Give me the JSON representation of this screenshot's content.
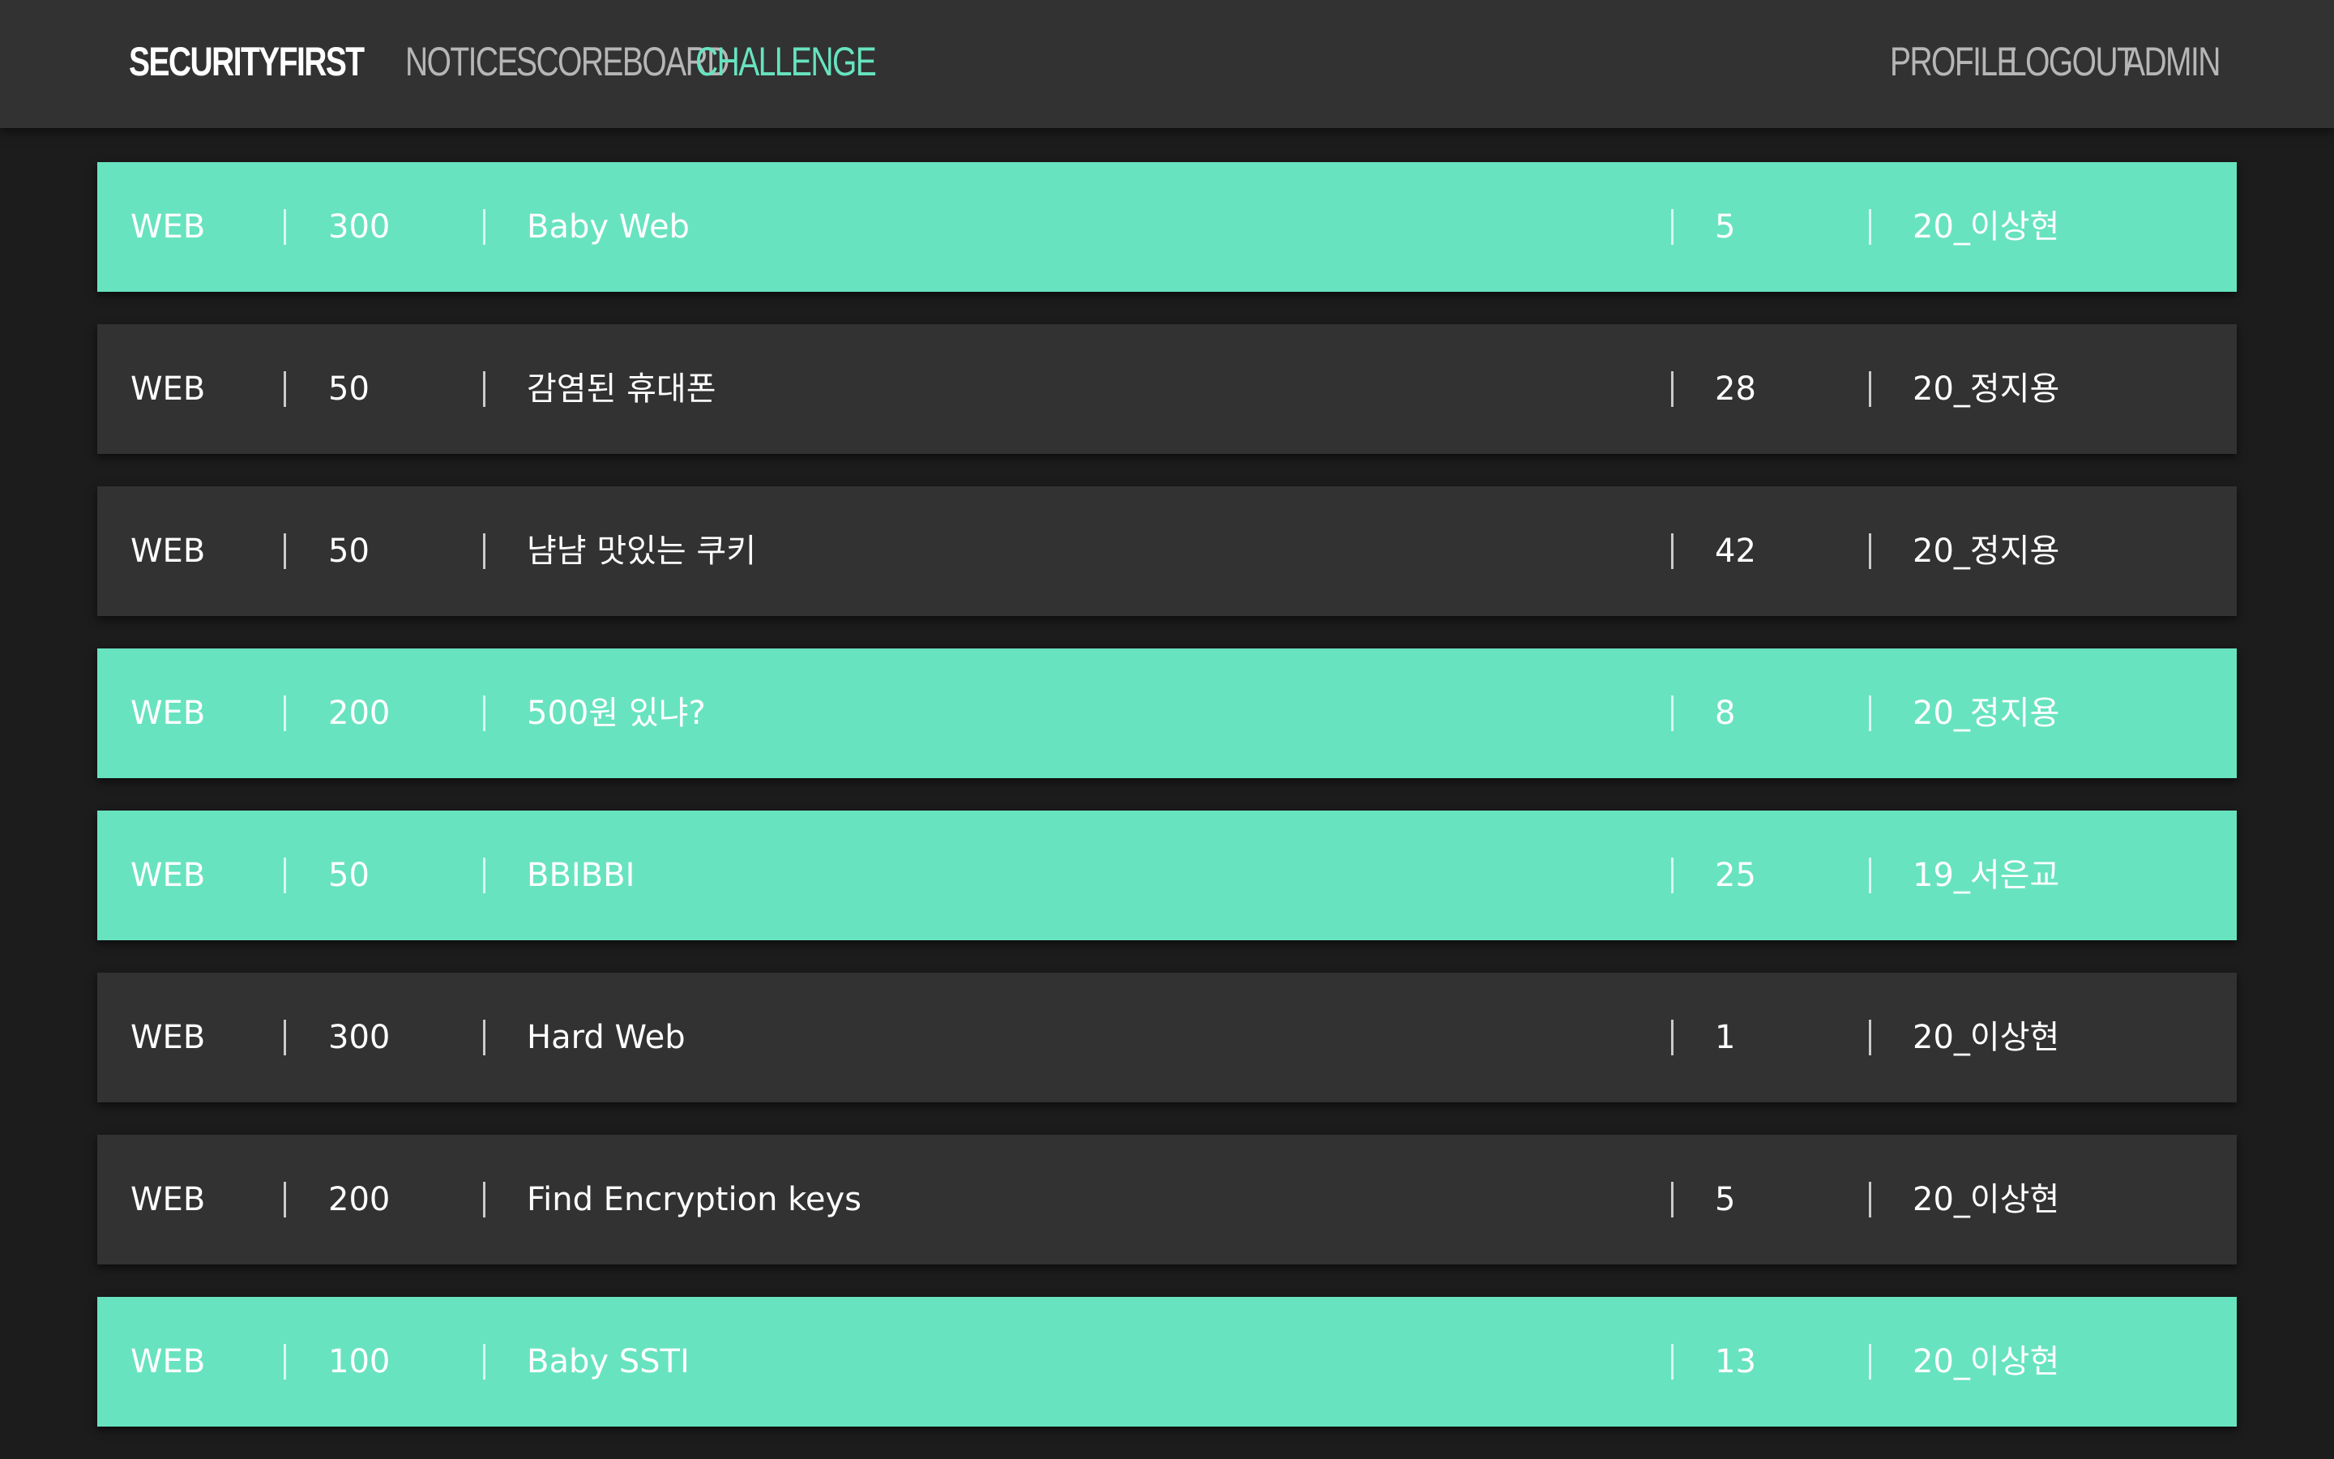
{
  "nav": {
    "brand": "SECURITYFIRST",
    "links": [
      "NOTICE",
      "SCOREBOARD",
      "CHALLENGE"
    ],
    "active": "CHALLENGE",
    "right_links": [
      "PROFILE",
      "LOGOUT",
      "ADMIN"
    ]
  },
  "colors": {
    "navbar_bg": "#323232",
    "page_bg": "#1c1c1c",
    "accent_solved": "#68e3bf",
    "unsolved_row": "#323232"
  },
  "challenges": [
    {
      "category": "WEB",
      "score": "300",
      "name": "Baby Web",
      "solves": "5",
      "author": "20_이상현",
      "solved": true
    },
    {
      "category": "WEB",
      "score": "50",
      "name": "감염된 휴대폰",
      "solves": "28",
      "author": "20_정지용",
      "solved": false
    },
    {
      "category": "WEB",
      "score": "50",
      "name": "냠냠 맛있는 쿠키",
      "solves": "42",
      "author": "20_정지용",
      "solved": false
    },
    {
      "category": "WEB",
      "score": "200",
      "name": "500원 있냐?",
      "solves": "8",
      "author": "20_정지용",
      "solved": true
    },
    {
      "category": "WEB",
      "score": "50",
      "name": "BBIBBI",
      "solves": "25",
      "author": "19_서은교",
      "solved": true
    },
    {
      "category": "WEB",
      "score": "300",
      "name": "Hard Web",
      "solves": "1",
      "author": "20_이상현",
      "solved": false
    },
    {
      "category": "WEB",
      "score": "200",
      "name": "Find Encryption keys",
      "solves": "5",
      "author": "20_이상현",
      "solved": false
    },
    {
      "category": "WEB",
      "score": "100",
      "name": "Baby SSTI",
      "solves": "13",
      "author": "20_이상현",
      "solved": true
    }
  ]
}
